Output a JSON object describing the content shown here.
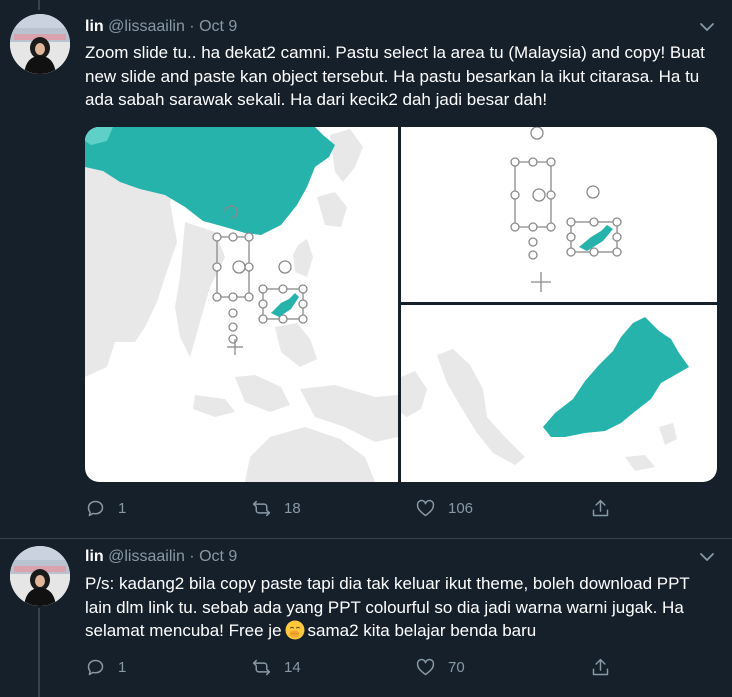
{
  "tweets": [
    {
      "author_name": "lin",
      "handle": "@lissaailin",
      "separator": "·",
      "date": "Oct 9",
      "text": "Zoom slide tu.. ha dekat2 camni. Pastu select la area tu (Malaysia) and copy! Buat new slide and paste kan object tersebut. Ha pastu besarkan la ikut citarasa. Ha tu ada sabah sarawak sekali. Ha dari kecik2 dah jadi besar dah!",
      "actions": {
        "replies": "1",
        "retweets": "18",
        "likes": "106"
      }
    },
    {
      "author_name": "lin",
      "handle": "@lissaailin",
      "separator": "·",
      "date": "Oct 9",
      "text_before_emoji": "P/s: kadang2 bila copy paste tapi dia tak keluar ikut theme, boleh download PPT lain dlm link tu.  sebab ada yang PPT colourful so dia jadi warna warni jugak. Ha selamat mencuba! Free je",
      "text_after_emoji": "sama2 kita belajar benda baru",
      "emoji": "hand-over-mouth-emoji",
      "actions": {
        "replies": "1",
        "retweets": "14",
        "likes": "70"
      }
    }
  ],
  "colors": {
    "background": "#15202b",
    "secondary_text": "#8899a6",
    "divider": "#38444d",
    "map_teal": "#26b3ac",
    "map_land": "#e8e8e8"
  },
  "icons": [
    "reply-icon",
    "retweet-icon",
    "like-icon",
    "share-icon",
    "chevron-down-icon"
  ]
}
